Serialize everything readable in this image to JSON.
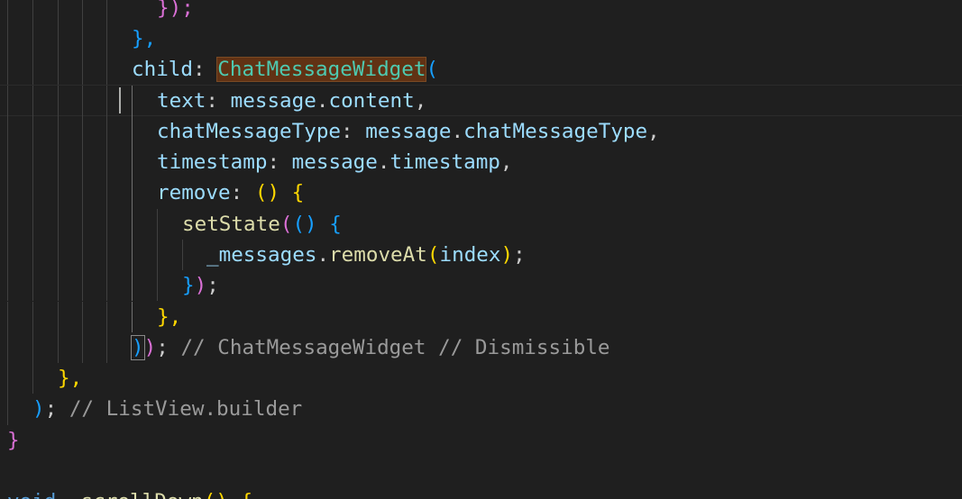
{
  "editor": {
    "lines": [
      {
        "tokens": [
          {
            "t": "});",
            "c": "t-b2"
          }
        ]
      },
      {
        "tokens": [
          {
            "t": "},",
            "c": "t-b3"
          }
        ]
      },
      {
        "tokens": [
          {
            "t": "child",
            "c": "t-prop"
          },
          {
            "t": ": ",
            "c": "t-punc"
          },
          {
            "t": "ChatMessageWidget",
            "c": "t-class hl-word"
          },
          {
            "t": "(",
            "c": "t-b3"
          }
        ]
      },
      {
        "tokens": [
          {
            "t": "text",
            "c": "t-prop"
          },
          {
            "t": ": ",
            "c": "t-punc"
          },
          {
            "t": "message",
            "c": "t-prop"
          },
          {
            "t": ".",
            "c": "t-punc"
          },
          {
            "t": "content",
            "c": "t-prop"
          },
          {
            "t": ",",
            "c": "t-punc"
          }
        ]
      },
      {
        "tokens": [
          {
            "t": "chatMessageType",
            "c": "t-prop"
          },
          {
            "t": ": ",
            "c": "t-punc"
          },
          {
            "t": "message",
            "c": "t-prop"
          },
          {
            "t": ".",
            "c": "t-punc"
          },
          {
            "t": "chatMessageType",
            "c": "t-prop"
          },
          {
            "t": ",",
            "c": "t-punc"
          }
        ]
      },
      {
        "tokens": [
          {
            "t": "timestamp",
            "c": "t-prop"
          },
          {
            "t": ": ",
            "c": "t-punc"
          },
          {
            "t": "message",
            "c": "t-prop"
          },
          {
            "t": ".",
            "c": "t-punc"
          },
          {
            "t": "timestamp",
            "c": "t-prop"
          },
          {
            "t": ",",
            "c": "t-punc"
          }
        ]
      },
      {
        "tokens": [
          {
            "t": "remove",
            "c": "t-prop"
          },
          {
            "t": ": ",
            "c": "t-punc"
          },
          {
            "t": "()",
            "c": "t-b1"
          },
          {
            "t": " ",
            "c": "t-punc"
          },
          {
            "t": "{",
            "c": "t-b1"
          }
        ]
      },
      {
        "tokens": [
          {
            "t": "setState",
            "c": "t-func"
          },
          {
            "t": "(",
            "c": "t-b2"
          },
          {
            "t": "()",
            "c": "t-b3"
          },
          {
            "t": " ",
            "c": "t-punc"
          },
          {
            "t": "{",
            "c": "t-b3"
          }
        ]
      },
      {
        "tokens": [
          {
            "t": "_messages",
            "c": "t-prop"
          },
          {
            "t": ".",
            "c": "t-punc"
          },
          {
            "t": "removeAt",
            "c": "t-func"
          },
          {
            "t": "(",
            "c": "t-b1"
          },
          {
            "t": "index",
            "c": "t-prop"
          },
          {
            "t": ")",
            "c": "t-b1"
          },
          {
            "t": ";",
            "c": "t-punc"
          }
        ]
      },
      {
        "tokens": [
          {
            "t": "}",
            "c": "t-b3"
          },
          {
            "t": ")",
            "c": "t-b2"
          },
          {
            "t": ";",
            "c": "t-punc"
          }
        ]
      },
      {
        "tokens": [
          {
            "t": "},",
            "c": "t-b1"
          }
        ]
      },
      {
        "tokens": [
          {
            "t": ")",
            "c": "t-b3 bracket-match"
          },
          {
            "t": ")",
            "c": "t-b2"
          },
          {
            "t": "; ",
            "c": "t-punc"
          },
          {
            "t": "// ChatMessageWidget // Dismissible",
            "c": "t-comment"
          }
        ]
      },
      {
        "tokens": [
          {
            "t": "},",
            "c": "t-b1"
          }
        ]
      },
      {
        "tokens": [
          {
            "t": ")",
            "c": "t-b3"
          },
          {
            "t": "; ",
            "c": "t-punc"
          },
          {
            "t": "// ListView.builder",
            "c": "t-comment"
          }
        ]
      },
      {
        "tokens": [
          {
            "t": "}",
            "c": "t-b2"
          }
        ]
      },
      {
        "tokens": []
      },
      {
        "tokens": [
          {
            "t": "void",
            "c": "t-kw"
          },
          {
            "t": " ",
            "c": "t-punc"
          },
          {
            "t": "_scrollDown",
            "c": "t-func"
          },
          {
            "t": "()",
            "c": "t-b1"
          },
          {
            "t": " ",
            "c": "t-punc"
          },
          {
            "t": "{",
            "c": "t-b1"
          }
        ]
      }
    ]
  }
}
